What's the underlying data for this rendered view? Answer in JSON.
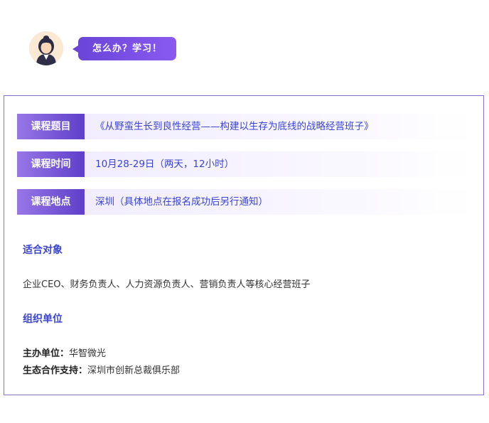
{
  "header": {
    "bubble_text": "怎么办？学习！"
  },
  "course": {
    "rows": [
      {
        "label": "课程题目",
        "value": "《从野蛮生长到良性经营——构建以生存为底线的战略经营班子》"
      },
      {
        "label": "课程时间",
        "value": "10月28-29日（两天，12小时）"
      },
      {
        "label": "课程地点",
        "value": "深圳（具体地点在报名成功后另行通知）"
      }
    ]
  },
  "audience": {
    "title": "适合对象",
    "text": "企业CEO、财务负责人、人力资源负责人、营销负责人等核心经营班子"
  },
  "organizer": {
    "title": "组织单位",
    "host_label": "主办单位：",
    "host_value": "华智微光",
    "partner_label": "生态合作支持：",
    "partner_value": "深圳市创新总裁俱乐部"
  },
  "colors": {
    "accent": "#3a44d0",
    "purple": "#6a45d8",
    "border": "#8a72c9"
  }
}
